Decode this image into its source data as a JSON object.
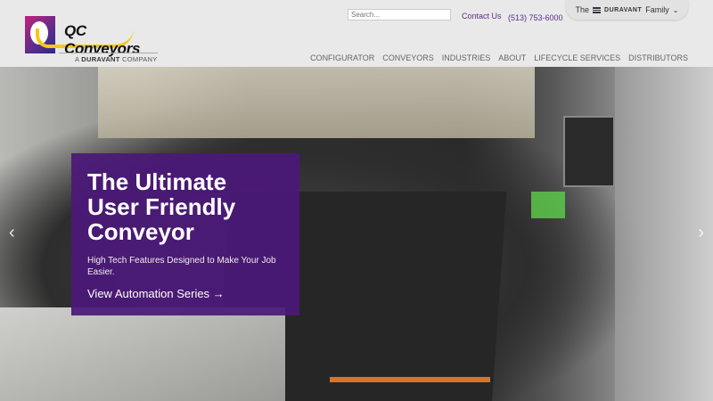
{
  "brand": {
    "name": "QC Conveyors",
    "tagline_prefix": "A",
    "tagline_brand": "DURAVANT",
    "tagline_suffix": "COMPANY"
  },
  "utility": {
    "search_placeholder": "Search...",
    "contact": "Contact Us",
    "phone": "(513) 753-6000"
  },
  "family": {
    "prefix": "The",
    "brand": "DURAVANT",
    "suffix": "Family",
    "icon": "chevron-down-icon"
  },
  "nav": [
    "CONFIGURATOR",
    "CONVEYORS",
    "INDUSTRIES",
    "ABOUT",
    "LIFECYCLE SERVICES",
    "DISTRIBUTORS"
  ],
  "hero": {
    "title": "The Ultimate User Friendly Conveyor",
    "subtitle": "High Tech Features Designed to Make Your Job Easier.",
    "cta": "View Automation Series →",
    "prev": "‹",
    "next": "›"
  },
  "colors": {
    "brand_purple": "#5b2d8e",
    "logo_yellow": "#f4c81a"
  }
}
